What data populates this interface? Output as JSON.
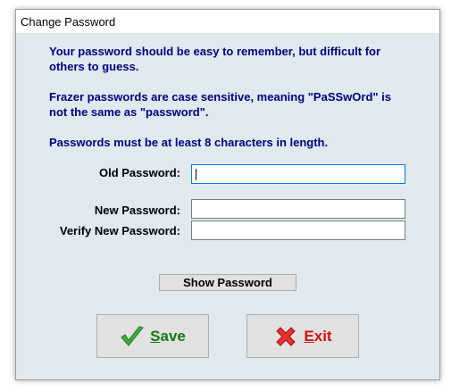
{
  "window": {
    "title": "Change Password"
  },
  "info": {
    "line1": "Your password should be easy to remember, but difficult for others to guess.",
    "line2": "Frazer passwords are case sensitive, meaning \"PaSSwOrd\" is not the same as \"password\".",
    "line3": "Passwords must be at least 8 characters in length."
  },
  "form": {
    "old_label": "Old Password:",
    "old_value": "",
    "new_label": "New Password:",
    "new_value": "",
    "verify_label": "Verify New Password:",
    "verify_value": ""
  },
  "buttons": {
    "show_label": "Show Password",
    "save_accel": "S",
    "save_rest": "ave",
    "exit_accel": "E",
    "exit_rest": "xit"
  },
  "icons": {
    "save": "checkmark-icon",
    "exit": "x-icon"
  },
  "colors": {
    "info_text": "#000080",
    "save_text": "#137a13",
    "exit_text": "#d01010",
    "focus_border": "#0078d7"
  }
}
